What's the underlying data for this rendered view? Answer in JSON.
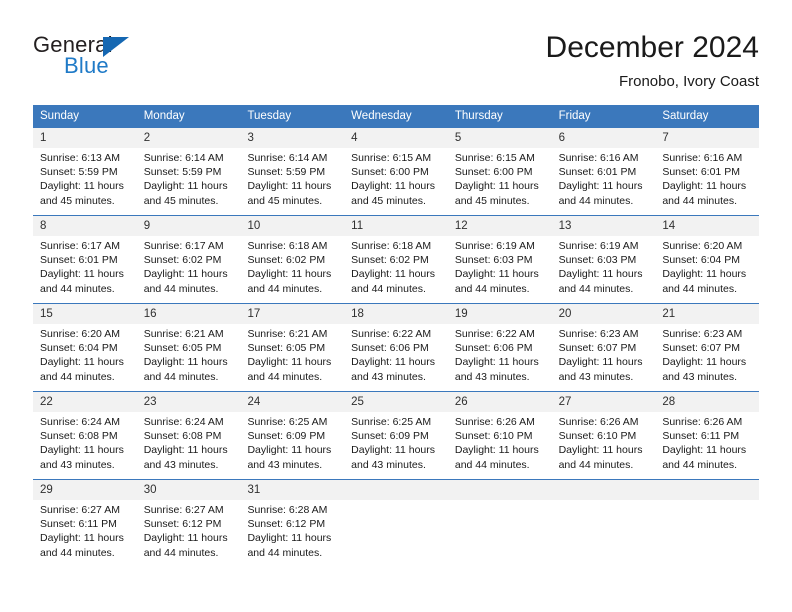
{
  "logo": {
    "word_top": "General",
    "word_bottom": "Blue",
    "triangle_color": "#1567b2",
    "blue_text_color": "#1f7ac7"
  },
  "header": {
    "title": "December 2024",
    "subtitle": "Fronobo, Ivory Coast"
  },
  "theme": {
    "header_blue": "#3b78bc",
    "daynum_band": "#f2f2f2",
    "text": "#1a1a1a"
  },
  "weekdays": [
    "Sunday",
    "Monday",
    "Tuesday",
    "Wednesday",
    "Thursday",
    "Friday",
    "Saturday"
  ],
  "weeks": [
    {
      "days": [
        {
          "num": "1",
          "sunrise": "Sunrise: 6:13 AM",
          "sunset": "Sunset: 5:59 PM",
          "daylight1": "Daylight: 11 hours",
          "daylight2": "and 45 minutes."
        },
        {
          "num": "2",
          "sunrise": "Sunrise: 6:14 AM",
          "sunset": "Sunset: 5:59 PM",
          "daylight1": "Daylight: 11 hours",
          "daylight2": "and 45 minutes."
        },
        {
          "num": "3",
          "sunrise": "Sunrise: 6:14 AM",
          "sunset": "Sunset: 5:59 PM",
          "daylight1": "Daylight: 11 hours",
          "daylight2": "and 45 minutes."
        },
        {
          "num": "4",
          "sunrise": "Sunrise: 6:15 AM",
          "sunset": "Sunset: 6:00 PM",
          "daylight1": "Daylight: 11 hours",
          "daylight2": "and 45 minutes."
        },
        {
          "num": "5",
          "sunrise": "Sunrise: 6:15 AM",
          "sunset": "Sunset: 6:00 PM",
          "daylight1": "Daylight: 11 hours",
          "daylight2": "and 45 minutes."
        },
        {
          "num": "6",
          "sunrise": "Sunrise: 6:16 AM",
          "sunset": "Sunset: 6:01 PM",
          "daylight1": "Daylight: 11 hours",
          "daylight2": "and 44 minutes."
        },
        {
          "num": "7",
          "sunrise": "Sunrise: 6:16 AM",
          "sunset": "Sunset: 6:01 PM",
          "daylight1": "Daylight: 11 hours",
          "daylight2": "and 44 minutes."
        }
      ]
    },
    {
      "days": [
        {
          "num": "8",
          "sunrise": "Sunrise: 6:17 AM",
          "sunset": "Sunset: 6:01 PM",
          "daylight1": "Daylight: 11 hours",
          "daylight2": "and 44 minutes."
        },
        {
          "num": "9",
          "sunrise": "Sunrise: 6:17 AM",
          "sunset": "Sunset: 6:02 PM",
          "daylight1": "Daylight: 11 hours",
          "daylight2": "and 44 minutes."
        },
        {
          "num": "10",
          "sunrise": "Sunrise: 6:18 AM",
          "sunset": "Sunset: 6:02 PM",
          "daylight1": "Daylight: 11 hours",
          "daylight2": "and 44 minutes."
        },
        {
          "num": "11",
          "sunrise": "Sunrise: 6:18 AM",
          "sunset": "Sunset: 6:02 PM",
          "daylight1": "Daylight: 11 hours",
          "daylight2": "and 44 minutes."
        },
        {
          "num": "12",
          "sunrise": "Sunrise: 6:19 AM",
          "sunset": "Sunset: 6:03 PM",
          "daylight1": "Daylight: 11 hours",
          "daylight2": "and 44 minutes."
        },
        {
          "num": "13",
          "sunrise": "Sunrise: 6:19 AM",
          "sunset": "Sunset: 6:03 PM",
          "daylight1": "Daylight: 11 hours",
          "daylight2": "and 44 minutes."
        },
        {
          "num": "14",
          "sunrise": "Sunrise: 6:20 AM",
          "sunset": "Sunset: 6:04 PM",
          "daylight1": "Daylight: 11 hours",
          "daylight2": "and 44 minutes."
        }
      ]
    },
    {
      "days": [
        {
          "num": "15",
          "sunrise": "Sunrise: 6:20 AM",
          "sunset": "Sunset: 6:04 PM",
          "daylight1": "Daylight: 11 hours",
          "daylight2": "and 44 minutes."
        },
        {
          "num": "16",
          "sunrise": "Sunrise: 6:21 AM",
          "sunset": "Sunset: 6:05 PM",
          "daylight1": "Daylight: 11 hours",
          "daylight2": "and 44 minutes."
        },
        {
          "num": "17",
          "sunrise": "Sunrise: 6:21 AM",
          "sunset": "Sunset: 6:05 PM",
          "daylight1": "Daylight: 11 hours",
          "daylight2": "and 44 minutes."
        },
        {
          "num": "18",
          "sunrise": "Sunrise: 6:22 AM",
          "sunset": "Sunset: 6:06 PM",
          "daylight1": "Daylight: 11 hours",
          "daylight2": "and 43 minutes."
        },
        {
          "num": "19",
          "sunrise": "Sunrise: 6:22 AM",
          "sunset": "Sunset: 6:06 PM",
          "daylight1": "Daylight: 11 hours",
          "daylight2": "and 43 minutes."
        },
        {
          "num": "20",
          "sunrise": "Sunrise: 6:23 AM",
          "sunset": "Sunset: 6:07 PM",
          "daylight1": "Daylight: 11 hours",
          "daylight2": "and 43 minutes."
        },
        {
          "num": "21",
          "sunrise": "Sunrise: 6:23 AM",
          "sunset": "Sunset: 6:07 PM",
          "daylight1": "Daylight: 11 hours",
          "daylight2": "and 43 minutes."
        }
      ]
    },
    {
      "days": [
        {
          "num": "22",
          "sunrise": "Sunrise: 6:24 AM",
          "sunset": "Sunset: 6:08 PM",
          "daylight1": "Daylight: 11 hours",
          "daylight2": "and 43 minutes."
        },
        {
          "num": "23",
          "sunrise": "Sunrise: 6:24 AM",
          "sunset": "Sunset: 6:08 PM",
          "daylight1": "Daylight: 11 hours",
          "daylight2": "and 43 minutes."
        },
        {
          "num": "24",
          "sunrise": "Sunrise: 6:25 AM",
          "sunset": "Sunset: 6:09 PM",
          "daylight1": "Daylight: 11 hours",
          "daylight2": "and 43 minutes."
        },
        {
          "num": "25",
          "sunrise": "Sunrise: 6:25 AM",
          "sunset": "Sunset: 6:09 PM",
          "daylight1": "Daylight: 11 hours",
          "daylight2": "and 43 minutes."
        },
        {
          "num": "26",
          "sunrise": "Sunrise: 6:26 AM",
          "sunset": "Sunset: 6:10 PM",
          "daylight1": "Daylight: 11 hours",
          "daylight2": "and 44 minutes."
        },
        {
          "num": "27",
          "sunrise": "Sunrise: 6:26 AM",
          "sunset": "Sunset: 6:10 PM",
          "daylight1": "Daylight: 11 hours",
          "daylight2": "and 44 minutes."
        },
        {
          "num": "28",
          "sunrise": "Sunrise: 6:26 AM",
          "sunset": "Sunset: 6:11 PM",
          "daylight1": "Daylight: 11 hours",
          "daylight2": "and 44 minutes."
        }
      ]
    },
    {
      "days": [
        {
          "num": "29",
          "sunrise": "Sunrise: 6:27 AM",
          "sunset": "Sunset: 6:11 PM",
          "daylight1": "Daylight: 11 hours",
          "daylight2": "and 44 minutes."
        },
        {
          "num": "30",
          "sunrise": "Sunrise: 6:27 AM",
          "sunset": "Sunset: 6:12 PM",
          "daylight1": "Daylight: 11 hours",
          "daylight2": "and 44 minutes."
        },
        {
          "num": "31",
          "sunrise": "Sunrise: 6:28 AM",
          "sunset": "Sunset: 6:12 PM",
          "daylight1": "Daylight: 11 hours",
          "daylight2": "and 44 minutes."
        },
        {
          "num": "",
          "sunrise": "",
          "sunset": "",
          "daylight1": "",
          "daylight2": ""
        },
        {
          "num": "",
          "sunrise": "",
          "sunset": "",
          "daylight1": "",
          "daylight2": ""
        },
        {
          "num": "",
          "sunrise": "",
          "sunset": "",
          "daylight1": "",
          "daylight2": ""
        },
        {
          "num": "",
          "sunrise": "",
          "sunset": "",
          "daylight1": "",
          "daylight2": ""
        }
      ]
    }
  ]
}
